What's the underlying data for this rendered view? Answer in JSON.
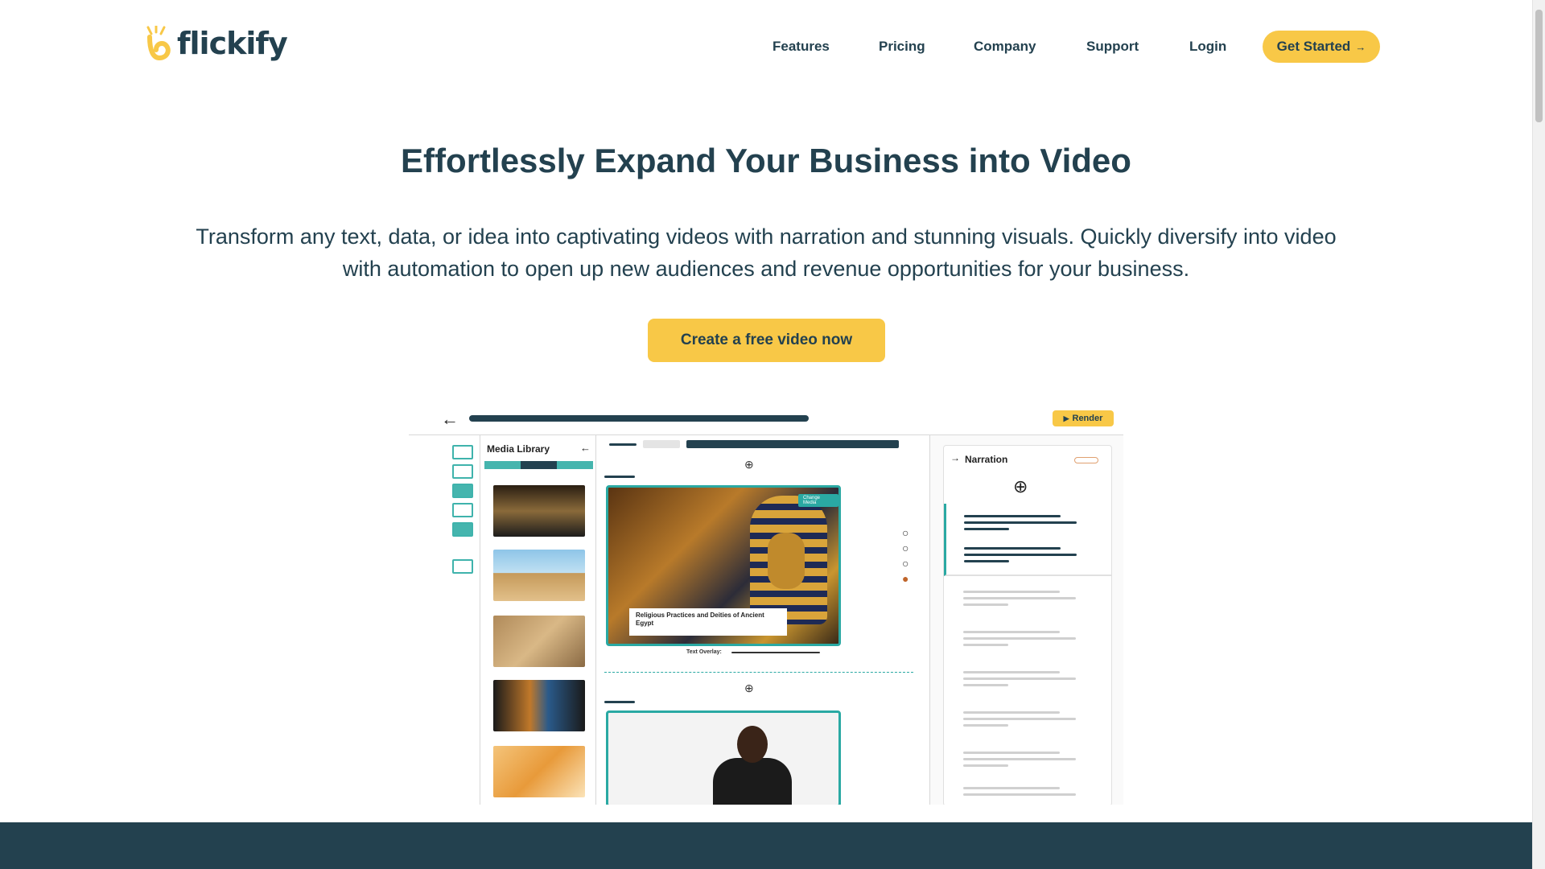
{
  "brand": {
    "name": "flickify"
  },
  "nav": {
    "items": [
      {
        "label": "Features"
      },
      {
        "label": "Pricing"
      },
      {
        "label": "Company"
      },
      {
        "label": "Support"
      },
      {
        "label": "Login"
      }
    ],
    "cta_label": "Get Started",
    "cta_arrow": "→"
  },
  "hero": {
    "title": "Effortlessly Expand Your Business into Video",
    "subtitle": "Transform any text, data, or idea into captivating videos with narration and stunning visuals.  Quickly diversify into video with automation to open up new audiences and revenue opportunities for your business.",
    "cta_label": "Create a free video now"
  },
  "mockup": {
    "render_label": "Render",
    "media_library_title": "Media Library",
    "narration_title": "Narration",
    "scene_caption": "Religious Practices and Deities of Ancient Egypt",
    "change_media_label": "Change Media",
    "text_overlay_label": "Text Overlay:"
  },
  "colors": {
    "accent_yellow": "#f8c847",
    "navy": "#23414f",
    "teal": "#2aa9a3"
  }
}
